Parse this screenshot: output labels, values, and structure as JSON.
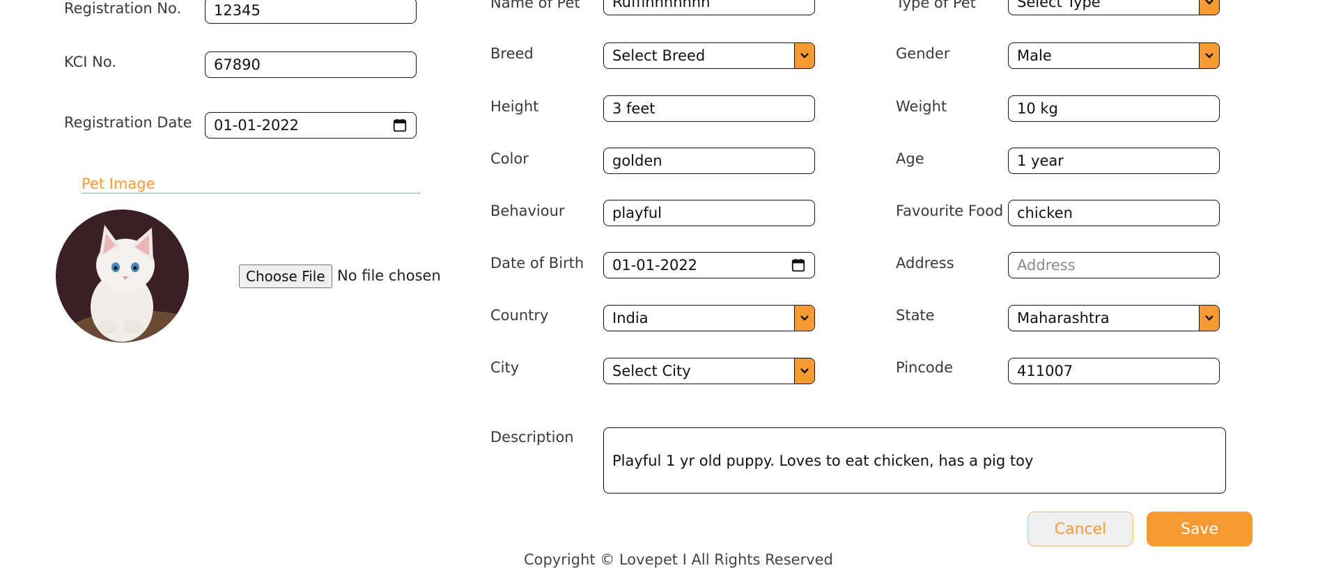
{
  "colors": {
    "accent": "#f89a34",
    "border": "#111111",
    "text": "#3a3a3a"
  },
  "left": {
    "registration_no": {
      "label": "Registration No.",
      "value": "12345"
    },
    "kci_no": {
      "label": "KCI No.",
      "value": "67890"
    },
    "registration_date": {
      "label": "Registration Date",
      "value": "01-01-2022"
    },
    "pet_image": {
      "title": "Pet Image",
      "choose_file_label": "Choose File",
      "file_status": "No file chosen"
    }
  },
  "form": {
    "name_of_pet": {
      "label": "Name of Pet",
      "value": "Ruffinnnnnnn"
    },
    "type_of_pet": {
      "label": "Type of Pet",
      "value": "Select Type"
    },
    "breed": {
      "label": "Breed",
      "value": "Select Breed"
    },
    "gender": {
      "label": "Gender",
      "value": "Male"
    },
    "height": {
      "label": "Height",
      "value": "3 feet"
    },
    "weight": {
      "label": "Weight",
      "value": "10 kg"
    },
    "color": {
      "label": "Color",
      "value": "golden"
    },
    "age": {
      "label": "Age",
      "value": "1 year"
    },
    "behaviour": {
      "label": "Behaviour",
      "value": "playful"
    },
    "favourite_food": {
      "label": "Favourite Food",
      "value": "chicken"
    },
    "date_of_birth": {
      "label": "Date of Birth",
      "value": "01-01-2022"
    },
    "address": {
      "label": "Address",
      "placeholder": "Address"
    },
    "country": {
      "label": "Country",
      "value": "India"
    },
    "state": {
      "label": "State",
      "value": "Maharashtra"
    },
    "city": {
      "label": "City",
      "value": "Select City"
    },
    "pincode": {
      "label": "Pincode",
      "value": "411007"
    },
    "description": {
      "label": "Description",
      "value": "Playful 1 yr old puppy. Loves to eat chicken, has a pig toy"
    }
  },
  "actions": {
    "cancel_label": "Cancel",
    "save_label": "Save"
  },
  "footer": {
    "copyright": "Copyright © Lovepet I All Rights Reserved"
  }
}
